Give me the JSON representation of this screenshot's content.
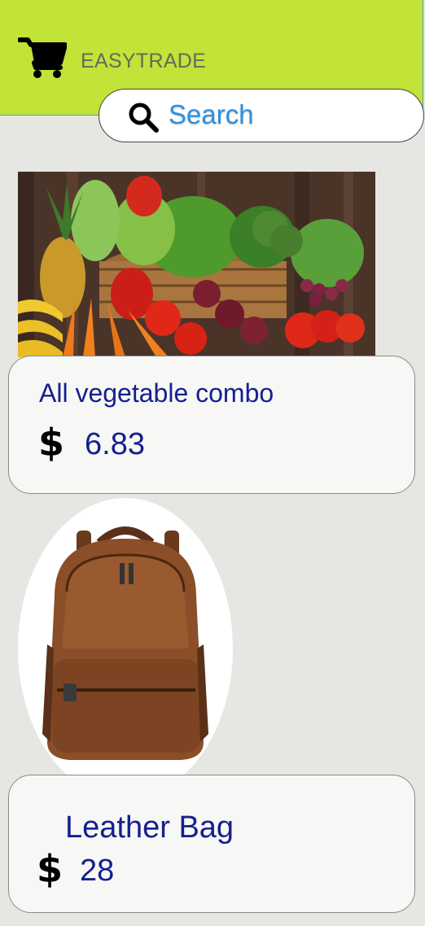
{
  "header": {
    "title": "EASYTRADE",
    "cart_icon": "shopping-cart-icon"
  },
  "search": {
    "placeholder": "Search",
    "icon": "search-icon"
  },
  "products": [
    {
      "name": "All vegetable combo",
      "price": "6.83",
      "currency_icon": "dollar-icon",
      "image": "vegetable-basket"
    },
    {
      "name": "Leather Bag",
      "price": "28",
      "currency_icon": "dollar-icon",
      "image": "leather-backpack"
    }
  ],
  "colors": {
    "header_bg": "#c2e337",
    "text_blue": "#15208e",
    "search_blue": "#2b8fe0",
    "page_bg": "#e6e6e2"
  }
}
